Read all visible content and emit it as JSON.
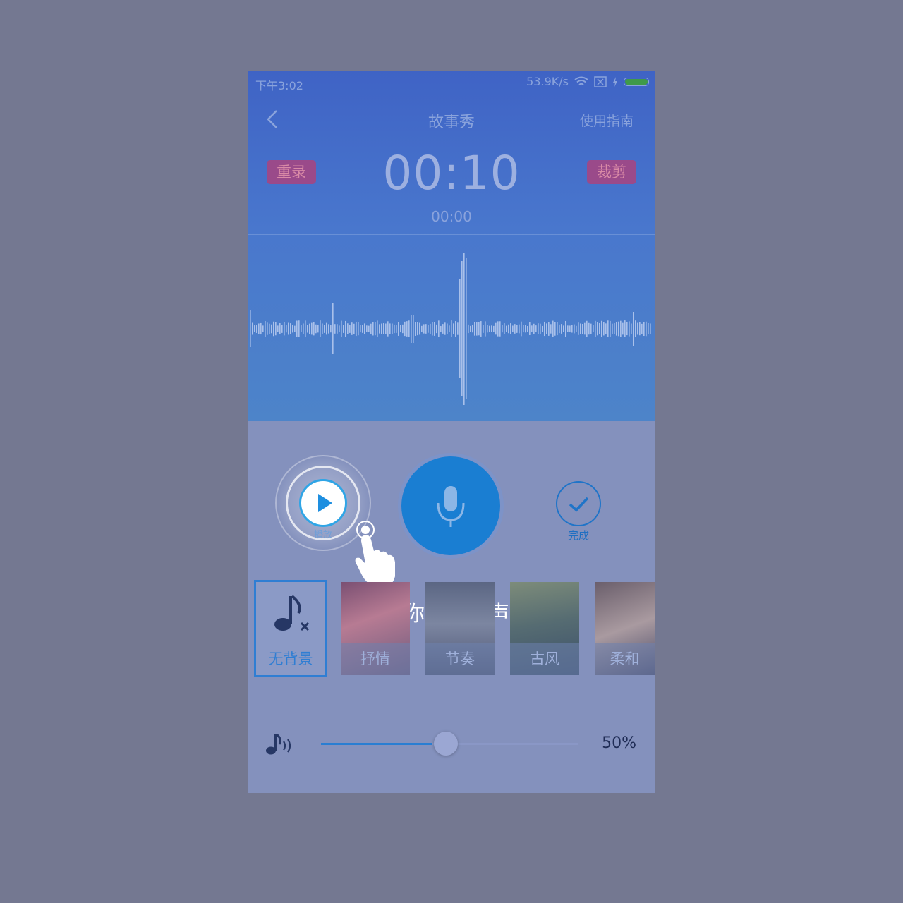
{
  "status_bar": {
    "time": "下午3:02",
    "network_speed": "53.9K/s"
  },
  "header": {
    "title": "故事秀",
    "guide_link": "使用指南",
    "back_icon": "chevron-left-icon"
  },
  "recorder": {
    "redo_label": "重录",
    "cut_label": "裁剪",
    "elapsed": "00:10",
    "position": "00:00"
  },
  "controls": {
    "play_label": "播放",
    "done_label": "完成",
    "mic_icon": "microphone-icon"
  },
  "tutorial_hint": "试听你录制的声音",
  "backgrounds": [
    {
      "label": "无背景",
      "selected": true
    },
    {
      "label": "抒情",
      "selected": false
    },
    {
      "label": "节奏",
      "selected": false
    },
    {
      "label": "古风",
      "selected": false
    },
    {
      "label": "柔和",
      "selected": false
    }
  ],
  "volume": {
    "label": "50%",
    "value": 0.5
  },
  "colors": {
    "accent": "#1a7ed2",
    "header_bg": "#4977cd",
    "overlay": "#747891",
    "pill_bg": "#9a4a8a"
  }
}
